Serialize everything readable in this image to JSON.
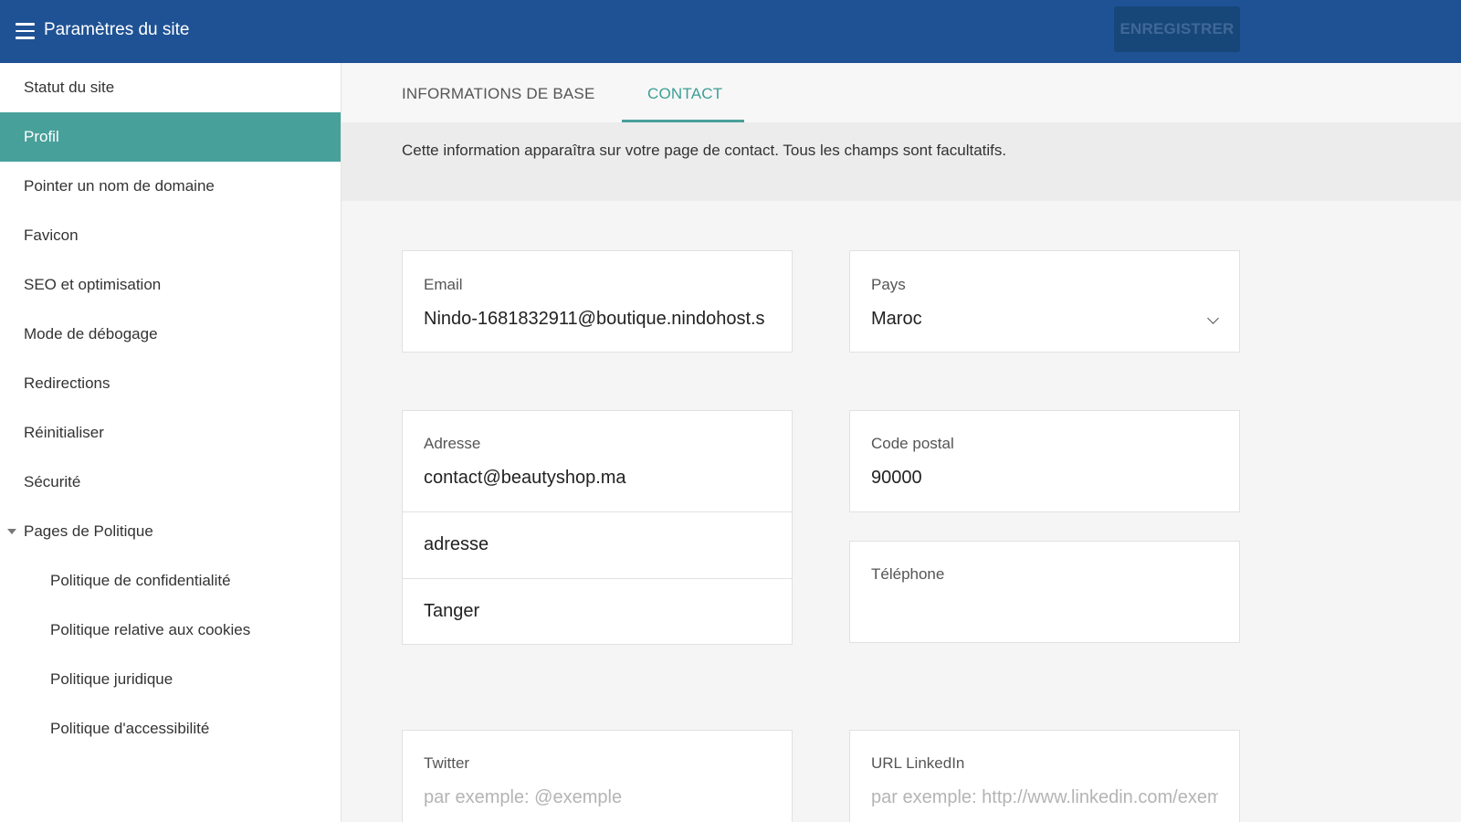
{
  "header": {
    "title": "Paramètres du site",
    "save_label": "ENREGISTRER"
  },
  "sidebar": {
    "items": [
      {
        "label": "Statut du site"
      },
      {
        "label": "Profil"
      },
      {
        "label": "Pointer un nom de domaine"
      },
      {
        "label": "Favicon"
      },
      {
        "label": "SEO et optimisation"
      },
      {
        "label": "Mode de débogage"
      },
      {
        "label": "Redirections"
      },
      {
        "label": "Réinitialiser"
      },
      {
        "label": "Sécurité"
      },
      {
        "label": "Pages de Politique"
      }
    ],
    "sub_items": [
      {
        "label": "Politique de confidentialité"
      },
      {
        "label": "Politique relative aux cookies"
      },
      {
        "label": "Politique juridique"
      },
      {
        "label": "Politique d'accessibilité"
      }
    ],
    "active_item": "Profil"
  },
  "tabs": [
    {
      "label": "INFORMATIONS DE BASE"
    },
    {
      "label": "CONTACT"
    }
  ],
  "active_tab": "CONTACT",
  "info_text": "Cette information apparaîtra sur votre page de contact. Tous les champs sont facultatifs.",
  "form": {
    "email": {
      "label": "Email",
      "value": "Nindo-1681832911@boutique.nindohost.s"
    },
    "country": {
      "label": "Pays",
      "value": "Maroc"
    },
    "address": {
      "label": "Adresse",
      "value": "contact@beautyshop.ma",
      "line2": "adresse",
      "line3": "Tanger"
    },
    "postal": {
      "label": "Code postal",
      "value": "90000"
    },
    "phone": {
      "label": "Téléphone",
      "value": ""
    },
    "twitter": {
      "label": "Twitter",
      "placeholder": "par exemple: @exemple"
    },
    "linkedin": {
      "label": "URL LinkedIn",
      "placeholder": "par exemple: http://www.linkedin.com/exem"
    }
  },
  "colors": {
    "header_bg": "#1e5294",
    "accent": "#48a09a",
    "save_btn_bg": "#174679"
  }
}
